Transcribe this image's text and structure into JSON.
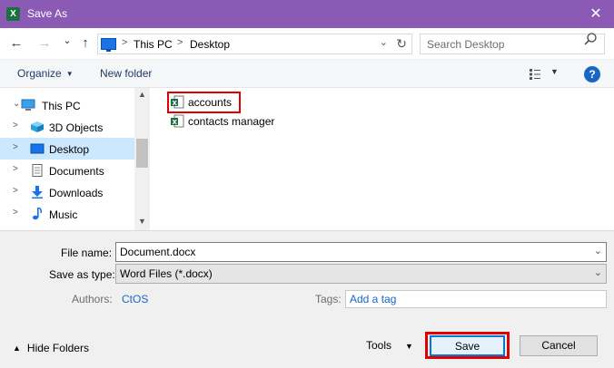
{
  "window": {
    "title": "Save As",
    "app_icon_letter": "X",
    "close_glyph": "✕"
  },
  "nav": {
    "back_glyph": "←",
    "forward_glyph": "→",
    "recent_glyph": "⌄",
    "up_glyph": "↑",
    "breadcrumbs": [
      "This PC",
      "Desktop"
    ],
    "breadcrumb_separator": ">",
    "search_placeholder": "Search Desktop"
  },
  "toolbar": {
    "organize_label": "Organize",
    "new_folder_label": "New folder",
    "help_label": "?"
  },
  "tree": {
    "items": [
      {
        "label": "This PC",
        "icon": "computer-icon",
        "expander": "⌄",
        "selected": false
      },
      {
        "label": "3D Objects",
        "icon": "3d-objects-icon",
        "expander": ">",
        "selected": false
      },
      {
        "label": "Desktop",
        "icon": "desktop-icon",
        "expander": ">",
        "selected": true
      },
      {
        "label": "Documents",
        "icon": "documents-icon",
        "expander": ">",
        "selected": false
      },
      {
        "label": "Downloads",
        "icon": "downloads-icon",
        "expander": ">",
        "selected": false
      },
      {
        "label": "Music",
        "icon": "music-icon",
        "expander": ">",
        "selected": false
      }
    ]
  },
  "files": {
    "items": [
      {
        "name": "accounts",
        "icon": "excel-file-icon",
        "highlighted": true
      },
      {
        "name": "contacts manager",
        "icon": "excel-file-icon",
        "highlighted": false
      }
    ]
  },
  "form": {
    "file_name_label": "File name:",
    "file_name_value": "Document.docx",
    "save_as_type_label": "Save as type:",
    "save_as_type_value": "Word Files (*.docx)",
    "authors_label": "Authors:",
    "authors_value": "CtOS",
    "tags_label": "Tags:",
    "tags_placeholder": "Add a tag",
    "hide_folders_label": "Hide Folders",
    "tools_label": "Tools",
    "save_label": "Save",
    "cancel_label": "Cancel"
  },
  "colors": {
    "titlebar": "#8a5ab4",
    "selection": "#cce8ff",
    "highlight_box": "#e00000",
    "link": "#1a66c6",
    "excel_green": "#1d6f42"
  }
}
